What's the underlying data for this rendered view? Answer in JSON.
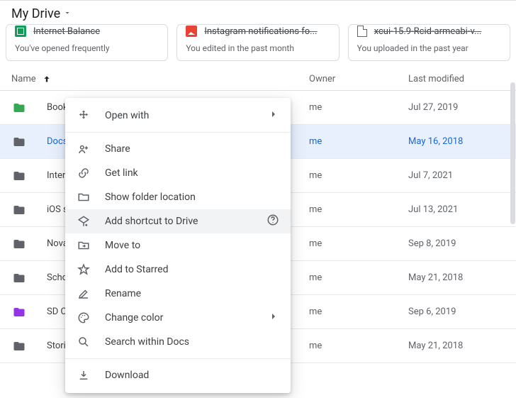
{
  "header": {
    "title": "My Drive"
  },
  "cards": [
    {
      "title": "Internet Balance",
      "sub": "You've opened frequently",
      "icon": "sheets"
    },
    {
      "title": "Instagram notifications fo...",
      "sub": "You edited in the past month",
      "icon": "image"
    },
    {
      "title": "xcui-15.9-Rcid-armeabi-v...",
      "sub": "You uploaded in the past year",
      "icon": "file"
    }
  ],
  "columns": {
    "name": "Name",
    "owner": "Owner",
    "modified": "Last modified"
  },
  "rows": [
    {
      "name": "Books",
      "owner": "me",
      "modified": "Jul 27, 2019",
      "color": "#34a853",
      "selected": false
    },
    {
      "name": "Docs",
      "owner": "me",
      "modified": "May 16, 2018",
      "color": "#5f6368",
      "selected": true
    },
    {
      "name": "Internet",
      "owner": "me",
      "modified": "Jul 7, 2021",
      "color": "#5f6368",
      "selected": false
    },
    {
      "name": "iOS screenshots",
      "owner": "me",
      "modified": "Jul 13, 2021",
      "color": "#5f6368",
      "selected": false
    },
    {
      "name": "Nova",
      "owner": "me",
      "modified": "Sep 8, 2019",
      "color": "#5f6368",
      "selected": false
    },
    {
      "name": "School",
      "owner": "me",
      "modified": "May 21, 2018",
      "color": "#5f6368",
      "selected": false
    },
    {
      "name": "SD Card",
      "owner": "me",
      "modified": "Sep 6, 2019",
      "color": "#9334e6",
      "selected": false
    },
    {
      "name": "Stories",
      "owner": "me",
      "modified": "May 21, 2018",
      "color": "#5f6368",
      "selected": false
    }
  ],
  "menu": {
    "open_with": "Open with",
    "share": "Share",
    "get_link": "Get link",
    "show_folder_location": "Show folder location",
    "add_shortcut": "Add shortcut to Drive",
    "move_to": "Move to",
    "add_to_starred": "Add to Starred",
    "rename": "Rename",
    "change_color": "Change color",
    "search_within": "Search within Docs",
    "download": "Download"
  }
}
